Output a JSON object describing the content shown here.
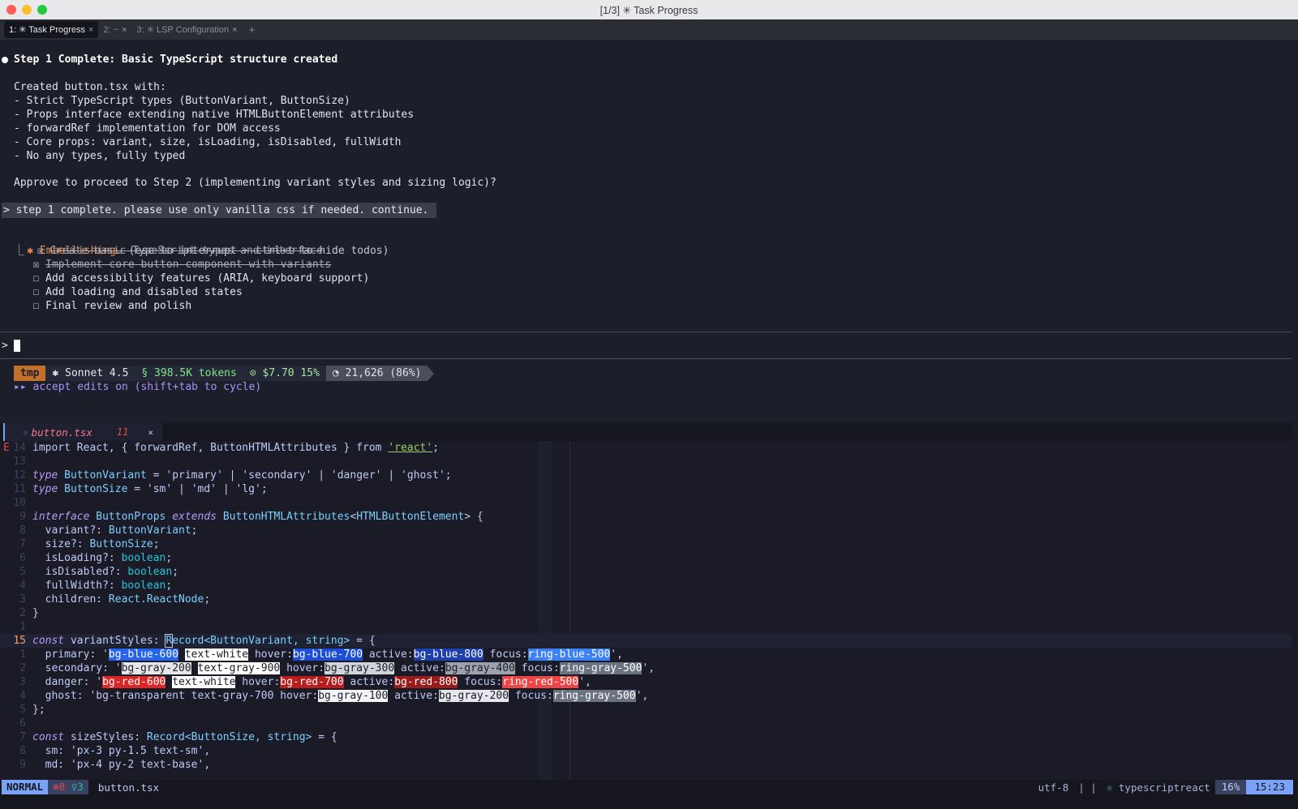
{
  "window": {
    "title": "[1/3] ✳ Task Progress"
  },
  "tabs": [
    {
      "label": "1: ✳ Task Progress",
      "close": "×"
    },
    {
      "label": "2: ~",
      "close": "×"
    },
    {
      "label": "3: ✳ LSP Configuration",
      "close": "×"
    }
  ],
  "tab_add": "+",
  "assistant": {
    "heading": "Step 1 Complete: Basic TypeScript structure created",
    "intro": "Created button.tsx with:",
    "points": [
      "- Strict TypeScript types (ButtonVariant, ButtonSize)",
      "- Props interface extending native HTMLButtonElement attributes",
      "- forwardRef implementation for DOM access",
      "- Core props: variant, size, isLoading, isDisabled, fullWidth",
      "- No any types, fully typed"
    ],
    "question": "Approve to proceed to Step 2 (implementing variant styles and sizing logic)?"
  },
  "user_message": "> step 1 complete. please use only vanilla css if needed. continue.",
  "working": {
    "star": "✱",
    "verb": "Embellishing…",
    "hint": " (esc to interrupt · ctrl+t to hide todos)",
    "branch": "⎿",
    "todos": [
      {
        "box": "☒",
        "text": "Create basic TypeScript types and interface",
        "done": true
      },
      {
        "box": "☒",
        "text": "Implement core button component with variants",
        "done": true
      },
      {
        "box": "☐",
        "text": "Add accessibility features (ARIA, keyboard support)",
        "done": false
      },
      {
        "box": "☐",
        "text": "Add loading and disabled states",
        "done": false
      },
      {
        "box": "☐",
        "text": "Final review and polish",
        "done": false
      }
    ]
  },
  "prompt": {
    "symbol": ">"
  },
  "status": {
    "dir": "tmp",
    "model": "✱ Sonnet 4.5",
    "tokens": "§ 398.5K tokens",
    "cost": "⊙ $7.70 15%",
    "context": "◔ 21,626 (86%)",
    "accept": "▸▸ accept edits on (shift+tab to cycle)"
  },
  "editor": {
    "tab_filename": "button.tsx",
    "tab_errors": "11",
    "tab_close": "×",
    "sign": "E",
    "lines": [
      {
        "ln": "14",
        "segs": [
          [
            "pl",
            "import React, { forwardRef, ButtonHTMLAttributes } "
          ],
          [
            "pl",
            "from "
          ],
          [
            "und",
            "'react'"
          ],
          [
            "pl",
            ";"
          ]
        ]
      },
      {
        "ln": "13",
        "segs": []
      },
      {
        "ln": "12",
        "segs": [
          [
            "kw",
            "type "
          ],
          [
            "ty",
            "ButtonVariant"
          ],
          [
            "pl",
            " = "
          ],
          [
            "strq",
            "'primary'"
          ],
          [
            "pl",
            " | "
          ],
          [
            "strq",
            "'secondary'"
          ],
          [
            "pl",
            " | "
          ],
          [
            "strq",
            "'danger'"
          ],
          [
            "pl",
            " | "
          ],
          [
            "strq",
            "'ghost'"
          ],
          [
            "pl",
            ";"
          ]
        ]
      },
      {
        "ln": "11",
        "segs": [
          [
            "kw",
            "type "
          ],
          [
            "ty",
            "ButtonSize"
          ],
          [
            "pl",
            " = "
          ],
          [
            "strq",
            "'sm'"
          ],
          [
            "pl",
            " | "
          ],
          [
            "strq",
            "'md'"
          ],
          [
            "pl",
            " | "
          ],
          [
            "strq",
            "'lg'"
          ],
          [
            "pl",
            ";"
          ]
        ]
      },
      {
        "ln": "10",
        "segs": []
      },
      {
        "ln": "9",
        "segs": [
          [
            "kw",
            "interface "
          ],
          [
            "ty",
            "ButtonProps "
          ],
          [
            "kw",
            "extends "
          ],
          [
            "ty",
            "ButtonHTMLAttributes"
          ],
          [
            "pl",
            "<"
          ],
          [
            "ty",
            "HTMLButtonElement"
          ],
          [
            "pl",
            "> {"
          ]
        ]
      },
      {
        "ln": "8",
        "segs": [
          [
            "pl",
            "  variant?: "
          ],
          [
            "ty",
            "ButtonVariant"
          ],
          [
            "pl",
            ";"
          ]
        ]
      },
      {
        "ln": "7",
        "segs": [
          [
            "pl",
            "  size?: "
          ],
          [
            "ty",
            "ButtonSize"
          ],
          [
            "pl",
            ";"
          ]
        ]
      },
      {
        "ln": "6",
        "segs": [
          [
            "pl",
            "  isLoading?: "
          ],
          [
            "ty2",
            "boolean"
          ],
          [
            "pl",
            ";"
          ]
        ]
      },
      {
        "ln": "5",
        "segs": [
          [
            "pl",
            "  isDisabled?: "
          ],
          [
            "ty2",
            "boolean"
          ],
          [
            "pl",
            ";"
          ]
        ]
      },
      {
        "ln": "4",
        "segs": [
          [
            "pl",
            "  fullWidth?: "
          ],
          [
            "ty2",
            "boolean"
          ],
          [
            "pl",
            ";"
          ]
        ]
      },
      {
        "ln": "3",
        "segs": [
          [
            "pl",
            "  children: "
          ],
          [
            "ty",
            "React.ReactNode"
          ],
          [
            "pl",
            ";"
          ]
        ]
      },
      {
        "ln": "2",
        "segs": [
          [
            "pl",
            "}"
          ]
        ]
      },
      {
        "ln": "1",
        "segs": []
      },
      {
        "ln": "15",
        "cur": true,
        "segs": [
          [
            "kw",
            "const "
          ],
          [
            "pl",
            "variantStyles: "
          ],
          [
            "tcur",
            "R"
          ],
          [
            "ty",
            "ecord<ButtonVariant, string>"
          ],
          [
            "pl",
            " = {"
          ]
        ]
      },
      {
        "ln": "1",
        "segs": [
          [
            "pl",
            "  primary: '"
          ],
          [
            "hl-blue6",
            "bg-blue-600"
          ],
          [
            "pl",
            " "
          ],
          [
            "hl-white",
            "text-white"
          ],
          [
            "pl",
            " hover:"
          ],
          [
            "hl-blue7",
            "bg-blue-700"
          ],
          [
            "pl",
            " active:"
          ],
          [
            "hl-blue8",
            "bg-blue-800"
          ],
          [
            "pl",
            " focus:"
          ],
          [
            "hl-blue5",
            "ring-blue-500"
          ],
          [
            "pl",
            "',"
          ]
        ]
      },
      {
        "ln": "2",
        "segs": [
          [
            "pl",
            "  secondary: '"
          ],
          [
            "hl-gray2",
            "bg-gray-200"
          ],
          [
            "pl",
            " "
          ],
          [
            "hl-white",
            "text-gray-900"
          ],
          [
            "pl",
            " hover:"
          ],
          [
            "hl-gray3",
            "bg-gray-300"
          ],
          [
            "pl",
            " active:"
          ],
          [
            "hl-gray4",
            "bg-gray-400"
          ],
          [
            "pl",
            " focus:"
          ],
          [
            "hl-gray5",
            "ring-gray-500"
          ],
          [
            "pl",
            "',"
          ]
        ]
      },
      {
        "ln": "3",
        "segs": [
          [
            "pl",
            "  danger: '"
          ],
          [
            "hl-red6",
            "bg-red-600"
          ],
          [
            "pl",
            " "
          ],
          [
            "hl-white",
            "text-white"
          ],
          [
            "pl",
            " hover:"
          ],
          [
            "hl-red7",
            "bg-red-700"
          ],
          [
            "pl",
            " active:"
          ],
          [
            "hl-red8",
            "bg-red-800"
          ],
          [
            "pl",
            " focus:"
          ],
          [
            "hl-red5",
            "ring-red-500"
          ],
          [
            "pl",
            "',"
          ]
        ]
      },
      {
        "ln": "4",
        "segs": [
          [
            "pl",
            "  ghost: 'bg-transparent text-gray-700 hover:"
          ],
          [
            "hl-gray1",
            "bg-gray-100"
          ],
          [
            "pl",
            " active:"
          ],
          [
            "hl-gray2",
            "bg-gray-200"
          ],
          [
            "pl",
            " focus:"
          ],
          [
            "hl-gray5",
            "ring-gray-500"
          ],
          [
            "pl",
            "',"
          ]
        ]
      },
      {
        "ln": "5",
        "segs": [
          [
            "pl",
            "};"
          ]
        ]
      },
      {
        "ln": "6",
        "segs": []
      },
      {
        "ln": "7",
        "segs": [
          [
            "kw",
            "const "
          ],
          [
            "pl",
            "sizeStyles: "
          ],
          [
            "ty",
            "Record<ButtonSize, string>"
          ],
          [
            "pl",
            " = {"
          ]
        ]
      },
      {
        "ln": "8",
        "segs": [
          [
            "pl",
            "  sm: 'px-3 py-1.5 text-sm',"
          ]
        ]
      },
      {
        "ln": "9",
        "segs": [
          [
            "pl",
            "  md: 'px-4 py-2 text-base',"
          ]
        ]
      }
    ]
  },
  "statusline": {
    "mode": "NORMAL",
    "errors": "⊗8",
    "hints": "♀3",
    "file": "button.tsx",
    "encoding": "utf-8",
    "os": "|  |",
    "filetype": "typescriptreact",
    "percent": "16%",
    "position": "15:23"
  },
  "colors": {
    "accent": "#7aa2f7",
    "orange": "#f08a45",
    "error": "#db4b4b"
  }
}
